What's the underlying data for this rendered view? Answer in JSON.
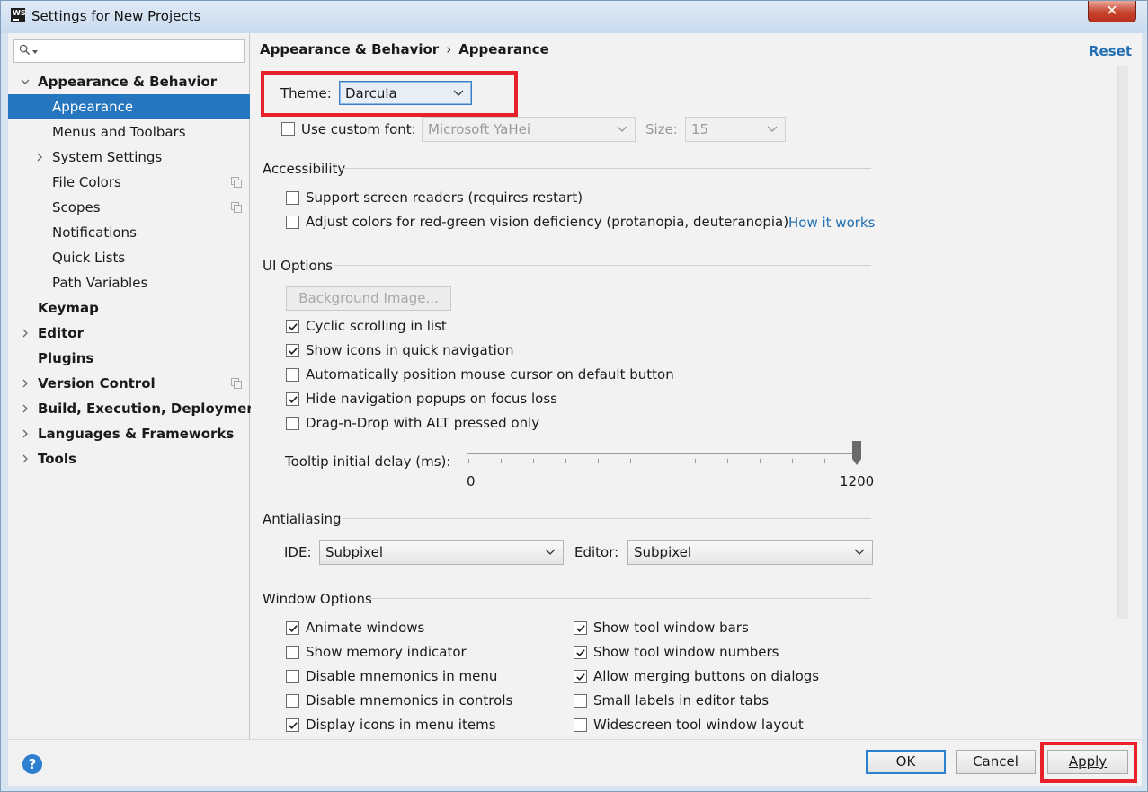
{
  "window": {
    "title": "Settings for New Projects",
    "close_symbol": "✕"
  },
  "sidebar": {
    "search_placeholder": "",
    "items": [
      {
        "label": "Appearance & Behavior",
        "level": 0,
        "bold": true,
        "expanded": true
      },
      {
        "label": "Appearance",
        "level": 1,
        "selected": true
      },
      {
        "label": "Menus and Toolbars",
        "level": 1
      },
      {
        "label": "System Settings",
        "level": 1,
        "collapsed": true
      },
      {
        "label": "File Colors",
        "level": 1,
        "copy_icon": true
      },
      {
        "label": "Scopes",
        "level": 1,
        "copy_icon": true
      },
      {
        "label": "Notifications",
        "level": 1
      },
      {
        "label": "Quick Lists",
        "level": 1
      },
      {
        "label": "Path Variables",
        "level": 1
      },
      {
        "label": "Keymap",
        "level": 0,
        "bold": true
      },
      {
        "label": "Editor",
        "level": 0,
        "bold": true,
        "collapsed": true
      },
      {
        "label": "Plugins",
        "level": 0,
        "bold": true
      },
      {
        "label": "Version Control",
        "level": 0,
        "bold": true,
        "collapsed": true,
        "copy_icon": true
      },
      {
        "label": "Build, Execution, Deployment",
        "level": 0,
        "bold": true,
        "collapsed": true
      },
      {
        "label": "Languages & Frameworks",
        "level": 0,
        "bold": true,
        "collapsed": true
      },
      {
        "label": "Tools",
        "level": 0,
        "bold": true,
        "collapsed": true
      }
    ]
  },
  "main": {
    "breadcrumb": [
      "Appearance & Behavior",
      "Appearance"
    ],
    "breadcrumb_sep": "›",
    "reset_label": "Reset",
    "theme_label": "Theme:",
    "theme_value": "Darcula",
    "custom_font_label": "Use custom font:",
    "custom_font_checked": false,
    "font_value": "Microsoft YaHei",
    "size_label": "Size:",
    "size_value": "15",
    "accessibility": {
      "title": "Accessibility",
      "options": [
        {
          "label": "Support screen readers (requires restart)",
          "checked": false
        },
        {
          "label": "Adjust colors for red-green vision deficiency (protanopia, deuteranopia)",
          "checked": false
        }
      ],
      "how_it_works": "How it works"
    },
    "ui_options": {
      "title": "UI Options",
      "background_image_button": "Background Image...",
      "options": [
        {
          "label": "Cyclic scrolling in list",
          "checked": true
        },
        {
          "label": "Show icons in quick navigation",
          "checked": true
        },
        {
          "label": "Automatically position mouse cursor on default button",
          "checked": false
        },
        {
          "label": "Hide navigation popups on focus loss",
          "checked": true
        },
        {
          "label": "Drag-n-Drop with ALT pressed only",
          "checked": false
        }
      ],
      "tooltip_label": "Tooltip initial delay (ms):",
      "tooltip_min": "0",
      "tooltip_max": "1200",
      "tooltip_value": 1200
    },
    "antialiasing": {
      "title": "Antialiasing",
      "ide_label": "IDE:",
      "ide_value": "Subpixel",
      "editor_label": "Editor:",
      "editor_value": "Subpixel"
    },
    "window_options": {
      "title": "Window Options",
      "left": [
        {
          "label": "Animate windows",
          "checked": true
        },
        {
          "label": "Show memory indicator",
          "checked": false
        },
        {
          "label": "Disable mnemonics in menu",
          "checked": false
        },
        {
          "label": "Disable mnemonics in controls",
          "checked": false
        },
        {
          "label": "Display icons in menu items",
          "checked": true
        }
      ],
      "right": [
        {
          "label": "Show tool window bars",
          "checked": true
        },
        {
          "label": "Show tool window numbers",
          "checked": true
        },
        {
          "label": "Allow merging buttons on dialogs",
          "checked": true
        },
        {
          "label": "Small labels in editor tabs",
          "checked": false
        },
        {
          "label": "Widescreen tool window layout",
          "checked": false
        }
      ]
    }
  },
  "footer": {
    "help": "?",
    "ok": "OK",
    "cancel": "Cancel",
    "apply": "Apply"
  },
  "colors": {
    "selection": "#2675bf",
    "link": "#2470b3",
    "highlight_box": "#e8202a",
    "default_button": "#2f7fd0"
  }
}
